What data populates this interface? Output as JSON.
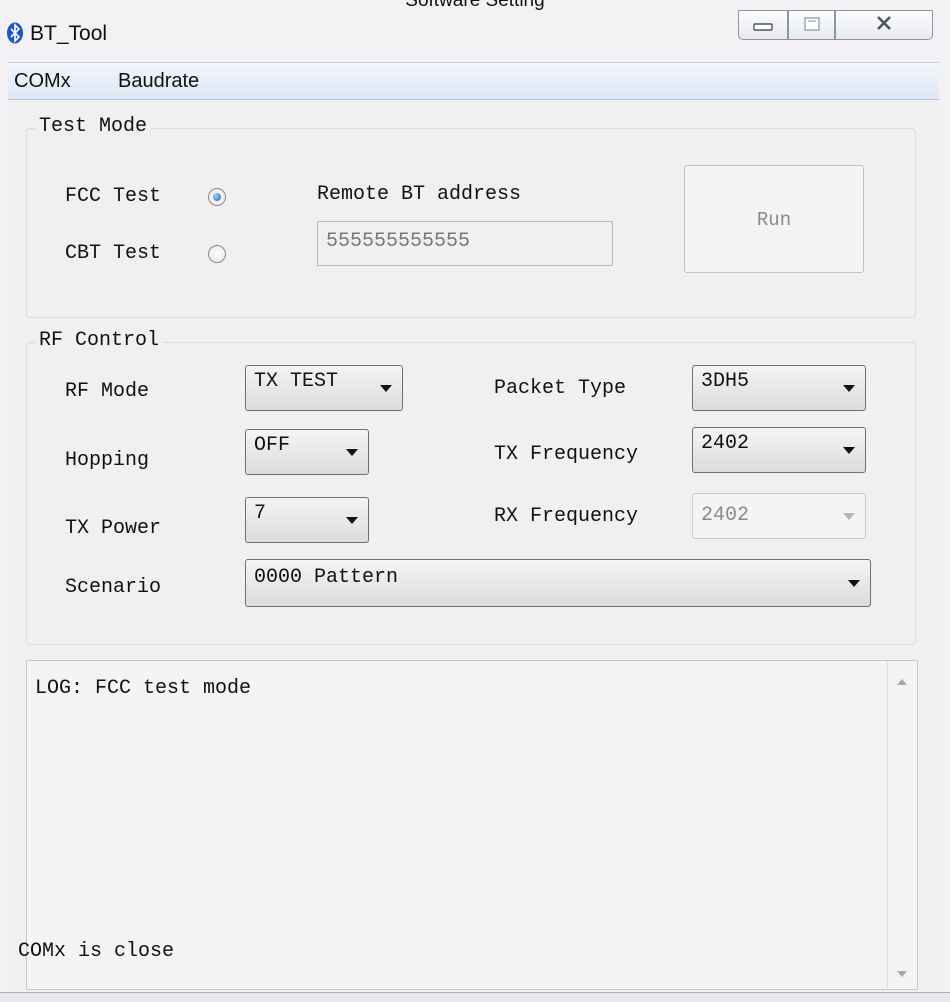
{
  "document_title": "Software Setting",
  "window": {
    "title": "BT_Tool"
  },
  "menu": [
    "COMx",
    "Baudrate"
  ],
  "test_mode": {
    "group_title": "Test Mode",
    "fcc_label": "FCC Test",
    "cbt_label": "CBT Test",
    "selected": "FCC Test",
    "remote_address_label": "Remote BT address",
    "remote_address_value": "555555555555",
    "run_label": "Run"
  },
  "rf_control": {
    "group_title": "RF Control",
    "rf_mode_label": "RF Mode",
    "rf_mode_value": "TX TEST",
    "hopping_label": "Hopping",
    "hopping_value": "OFF",
    "tx_power_label": "TX Power",
    "tx_power_value": "7",
    "scenario_label": "Scenario",
    "scenario_value": "0000 Pattern",
    "packet_type_label": "Packet Type",
    "packet_type_value": "3DH5",
    "tx_frequency_label": "TX Frequency",
    "tx_frequency_value": "2402",
    "rx_frequency_label": "RX Frequency",
    "rx_frequency_value": "2402"
  },
  "log": {
    "text": "LOG: FCC test mode"
  },
  "status": {
    "text": "COMx is close"
  }
}
